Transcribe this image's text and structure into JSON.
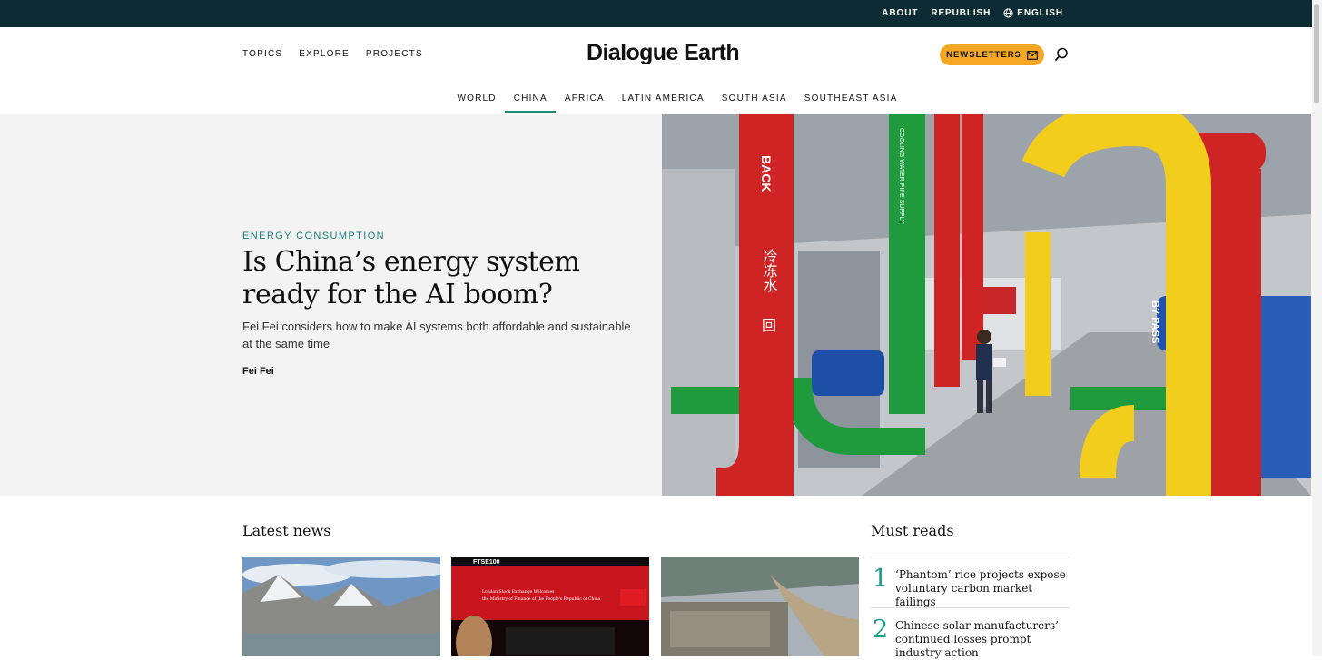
{
  "topbar": {
    "links": [
      "ABOUT",
      "REPUBLISH",
      "ENGLISH"
    ]
  },
  "header": {
    "nav": [
      "TOPICS",
      "EXPLORE",
      "PROJECTS"
    ],
    "logo": "Dialogue Earth",
    "newsletter_label": "NEWSLETTERS"
  },
  "regions": {
    "tabs": [
      "WORLD",
      "CHINA",
      "AFRICA",
      "LATIN AMERICA",
      "SOUTH ASIA",
      "SOUTHEAST ASIA"
    ],
    "active": "CHINA"
  },
  "hero": {
    "kicker": "ENERGY CONSUMPTION",
    "title": "Is China’s energy system ready for the AI boom?",
    "dek": "Fei Fei considers how to make AI systems both affordable and sustainable at the same time",
    "author": "Fei Fei",
    "image_labels": [
      "BACK",
      "冷冻水",
      "回",
      "BY PASS",
      "COOLING WATER PIPE SUPPLY"
    ]
  },
  "latest": {
    "title": "Latest news",
    "card2_text": [
      "FTSE100",
      "London Stock Exchange Welcomes",
      "the Ministry of Finance of the People's Republic of China"
    ]
  },
  "mustreads": {
    "title": "Must reads",
    "items": [
      {
        "num": "1",
        "text": "‘Phantom’ rice projects expose voluntary carbon market failings"
      },
      {
        "num": "2",
        "text": "Chinese solar manufacturers’ continued losses prompt industry action"
      }
    ]
  }
}
